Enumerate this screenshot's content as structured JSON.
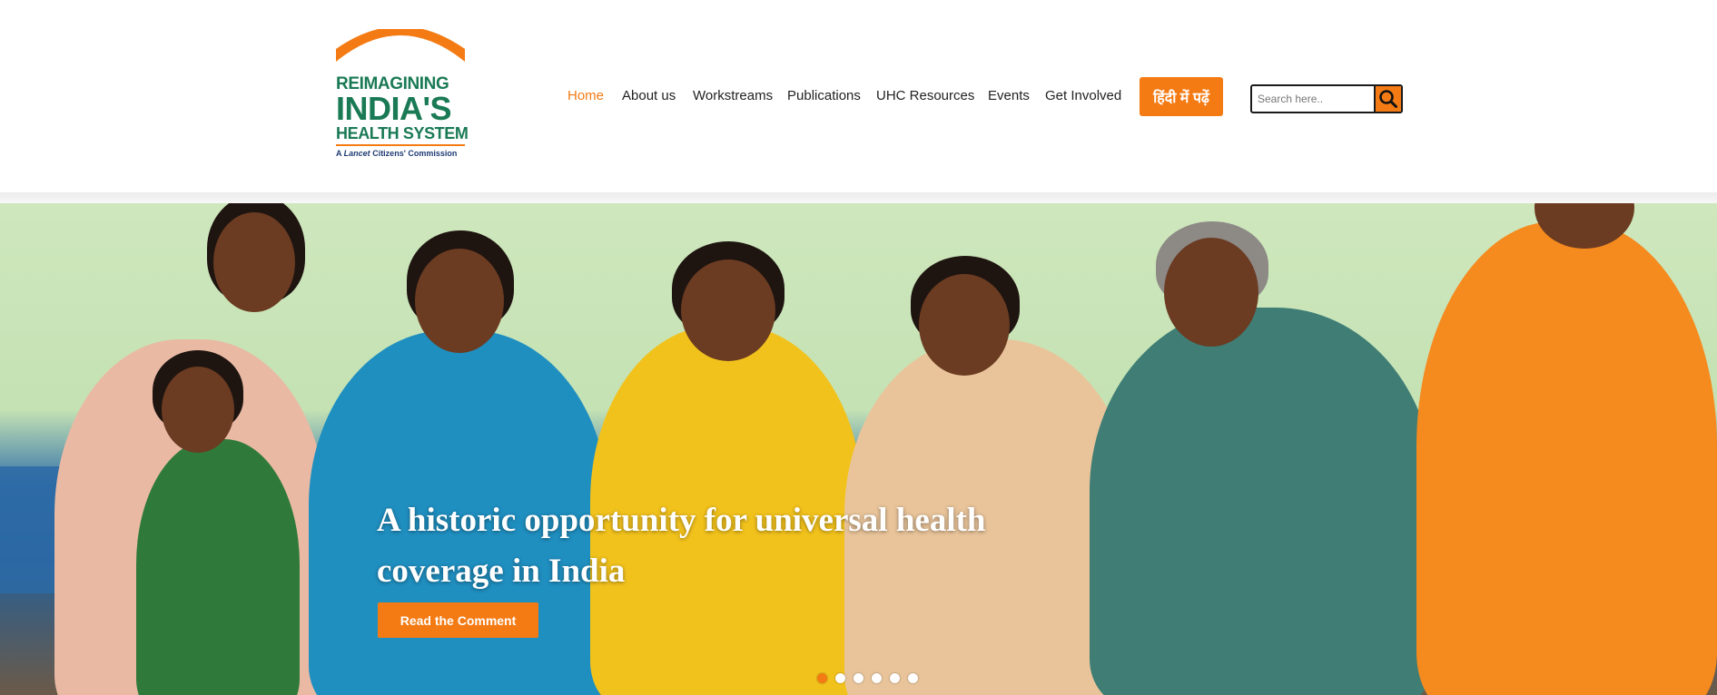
{
  "logo": {
    "line1": "REIMAGINING",
    "line2": "INDIA'S",
    "line3": "HEALTH SYSTEM",
    "subtitle_pre": "A ",
    "subtitle_italic": "Lancet",
    "subtitle_post": " Citizens' Commission"
  },
  "nav": {
    "items": [
      {
        "label": "Home",
        "active": true
      },
      {
        "label": "About us"
      },
      {
        "label": "Workstreams"
      },
      {
        "label": "Publications"
      },
      {
        "label": "UHC Resources"
      },
      {
        "label": "Events"
      },
      {
        "label": "Get Involved"
      }
    ]
  },
  "hindi_button": {
    "label": "हिंदी में पढ़ें"
  },
  "search": {
    "placeholder": "Search here..",
    "icon": "search-icon"
  },
  "hero": {
    "title": "A historic opportunity for universal health coverage in India",
    "button_label": "Read the Comment",
    "image": "group of women seated on a bench",
    "slide_count": 6,
    "active_slide": 1
  },
  "colors": {
    "accent": "#f47b14",
    "logo_green": "#1a7a55",
    "logo_navy": "#1f3b73"
  }
}
